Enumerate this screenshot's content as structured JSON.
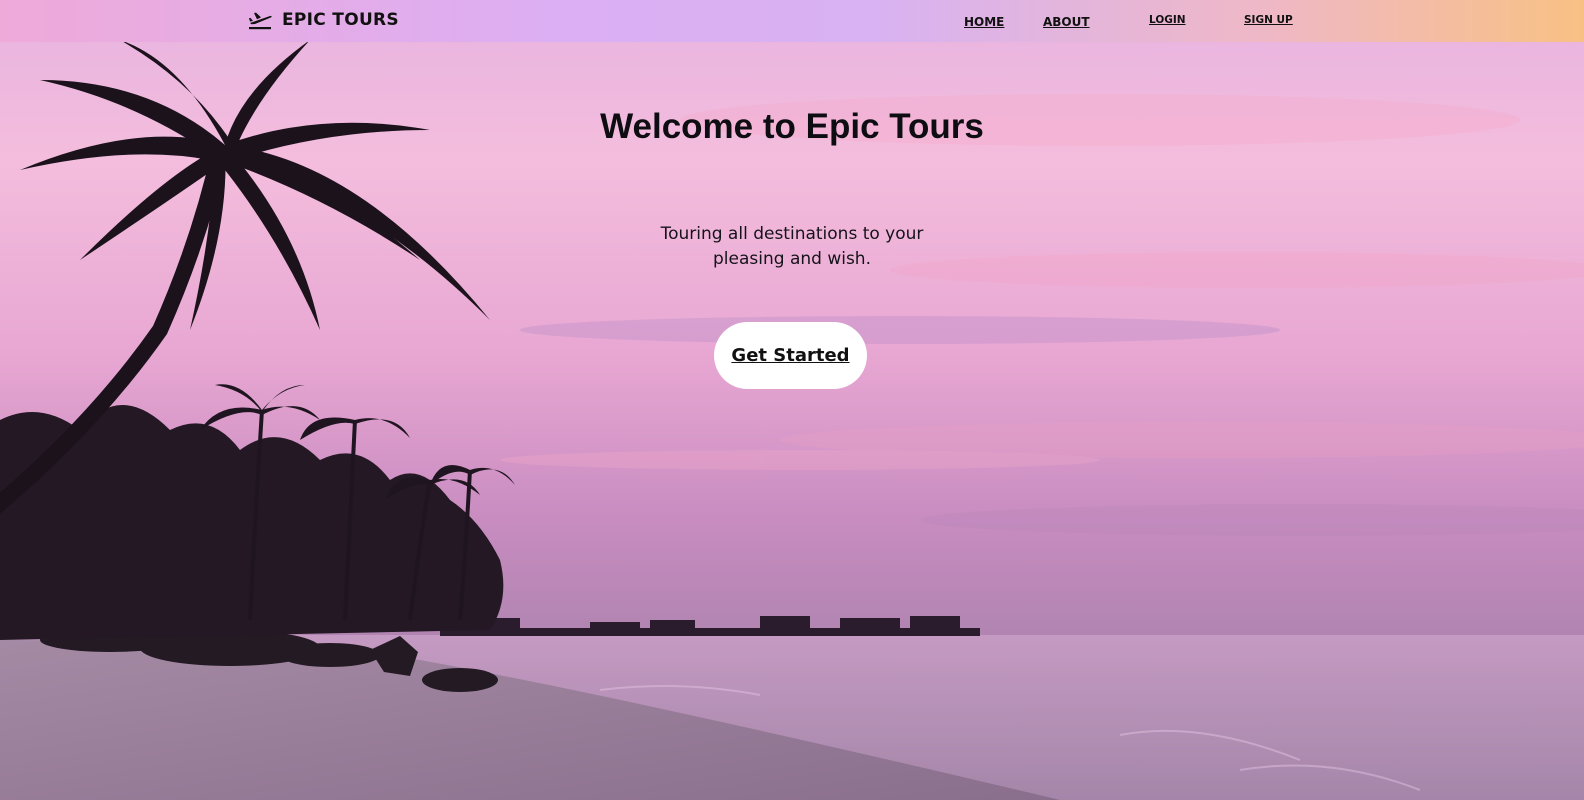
{
  "header": {
    "brand_name": "EPIC TOURS",
    "brand_icon": "airplane-departure-icon",
    "nav": {
      "home": "HOME",
      "about": "ABOUT",
      "login": "LOGIN",
      "signup": "SIGN UP"
    }
  },
  "hero": {
    "title": "Welcome to Epic Tours",
    "subtitle": "Touring all destinations to your pleasing and wish.",
    "cta_label": "Get Started",
    "background": "tropical-beach-sunset-image"
  },
  "colors": {
    "header_gradient_left": "#eeaad9",
    "header_gradient_mid": "#dcaef3",
    "header_gradient_right": "#f8c184",
    "cta_background": "#ffffff",
    "text": "#111111"
  }
}
